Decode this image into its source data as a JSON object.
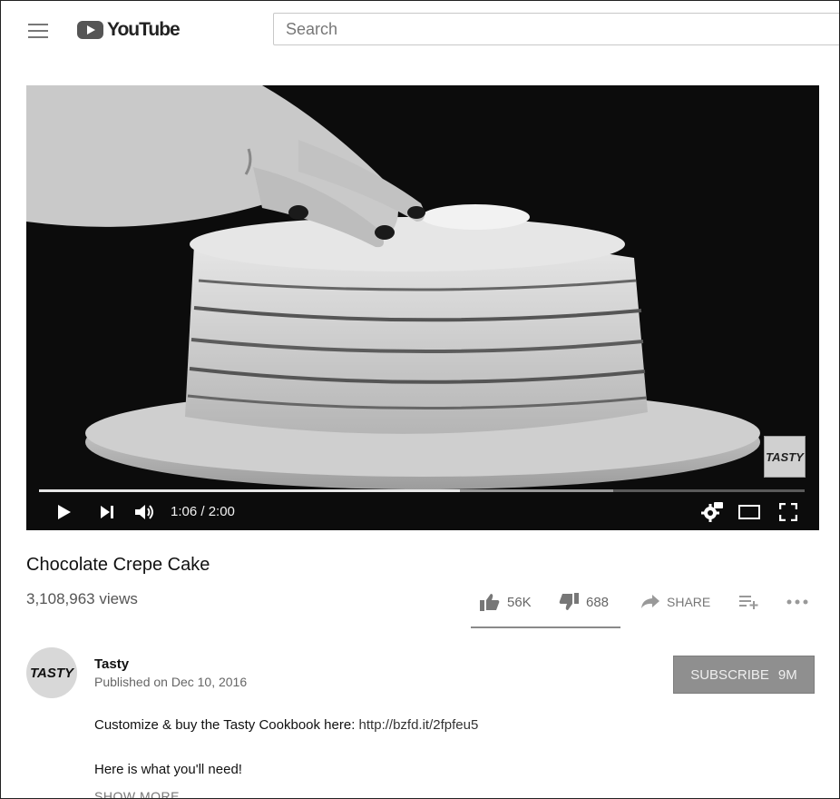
{
  "header": {
    "logo_text": "YouTube",
    "search_placeholder": "Search"
  },
  "player": {
    "current_time": "1:06",
    "duration": "2:00",
    "time_display": "1:06 / 2:00",
    "progress_fraction": 0.55,
    "buffered_fraction": 0.75,
    "watermark_text": "TASTY"
  },
  "video": {
    "title": "Chocolate Crepe Cake",
    "views": "3,108,963 views",
    "likes": "56K",
    "dislikes": "688",
    "share_label": "SHARE",
    "like_fraction": 0.99
  },
  "channel": {
    "name": "Tasty",
    "avatar_text": "TASTY",
    "published": "Published on Dec 10, 2016",
    "subscribe_label": "SUBSCRIBE",
    "subscriber_count": "9M"
  },
  "description": {
    "line1_text": "Customize & buy the Tasty Cookbook here: ",
    "line1_link": "http://bzfd.it/2fpfeu5",
    "line2_text": "Here is what you'll need!",
    "show_more": "SHOW MORE"
  },
  "colors": {
    "player_bg": "#0c0c0c",
    "subscribe_bg": "#8f8f8f"
  }
}
